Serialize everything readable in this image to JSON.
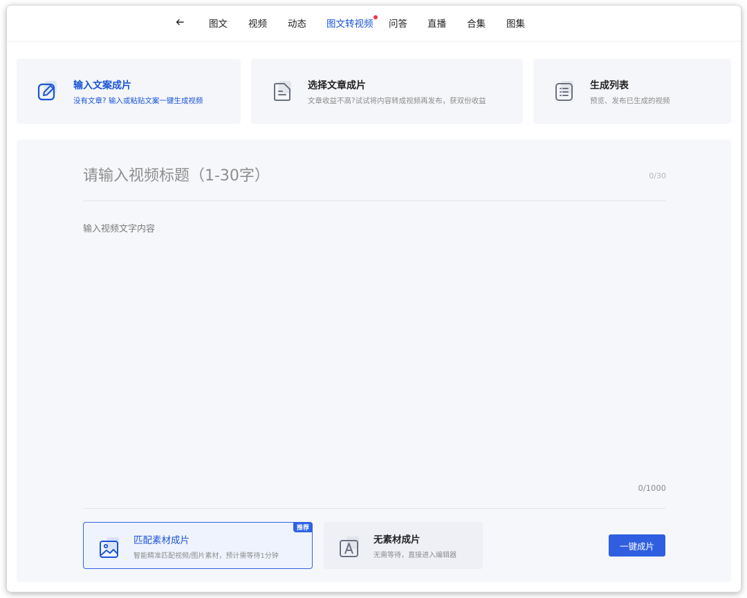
{
  "nav": {
    "back_icon": "back-arrow-icon",
    "items": [
      {
        "label": "图文"
      },
      {
        "label": "视频"
      },
      {
        "label": "动态"
      },
      {
        "label": "图文转视频",
        "active": true,
        "has_dot": true
      },
      {
        "label": "问答"
      },
      {
        "label": "直播"
      },
      {
        "label": "合集"
      },
      {
        "label": "图集"
      }
    ]
  },
  "source_cards": [
    {
      "title": "输入文案成片",
      "subtitle": "没有文章? 输入或粘贴文案一键生成视频",
      "icon": "edit-icon",
      "active": true
    },
    {
      "title": "选择文章成片",
      "subtitle": "文章收益不高?试试将内容转成视频再发布，获双份收益",
      "icon": "article-icon"
    },
    {
      "title": "生成列表",
      "subtitle": "预览、发布已生成的视频",
      "icon": "list-icon"
    }
  ],
  "editor": {
    "title_placeholder": "请输入视频标题（1-30字）",
    "title_value": "",
    "title_count": "0/30",
    "content_placeholder": "输入视频文字内容",
    "content_value": "",
    "content_count": "0/1000"
  },
  "modes": [
    {
      "title": "匹配素材成片",
      "subtitle": "智能精准匹配视频/图片素材，预计需等待1分钟",
      "icon": "image-icon",
      "selected": true,
      "badge": "推荐"
    },
    {
      "title": "无素材成片",
      "subtitle": "无需等待，直接进入编辑器",
      "icon": "text-a-icon",
      "selected": false
    }
  ],
  "generate_button": "一键成片",
  "colors": {
    "accent": "#2f5fe0",
    "active_text": "#1a54d6",
    "dot": "#f0344f"
  }
}
